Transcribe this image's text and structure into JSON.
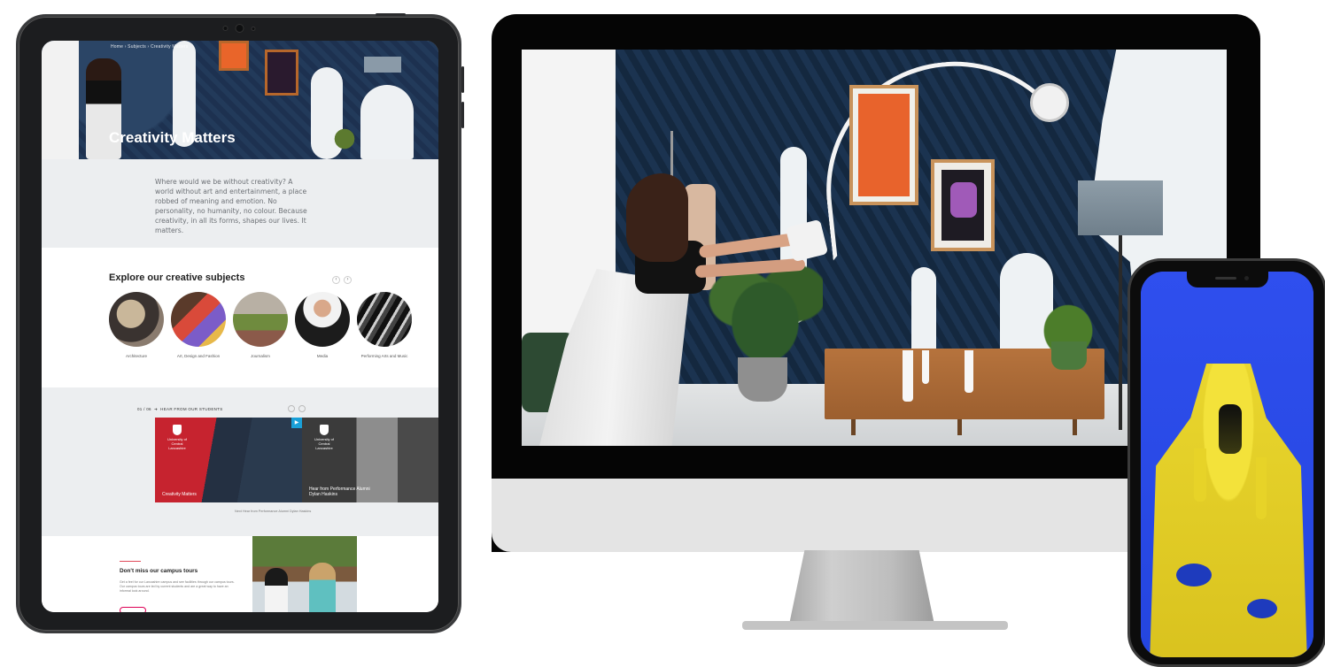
{
  "tablet": {
    "breadcrumb": "Home  ›  Subjects  ›  Creativity Matters",
    "hero_title": "Creativity Matters",
    "intro_text": "Where would we be without creativity? A world without art and entertainment, a place robbed of meaning and emotion. No personality, no humanity, no colour. Because creativity, in all its forms, shapes our lives. It matters.",
    "explore_heading": "Explore our creative subjects",
    "subjects": [
      {
        "label": "Architecture"
      },
      {
        "label": "Art, Design and Fashion"
      },
      {
        "label": "Journalism"
      },
      {
        "label": "Media"
      },
      {
        "label": "Performing Arts and Music"
      }
    ],
    "students_counter": "01 / 06",
    "students_heading": "HEAR FROM OUR STUDENTS",
    "cards": [
      {
        "logo": "University of Central Lancashire",
        "caption": "Creativity Matters"
      },
      {
        "logo": "University of Central Lancashire",
        "caption": "Hear from Performance Alumni Dylan Haskins"
      }
    ],
    "students_footer": "Next\nHear from Performance Alumni Dylan Haskins",
    "tours_heading": "Don't miss our campus tours",
    "tours_text": "Get a feel for our Lancashire campus and see facilities through our campus tours. Our campus tours are led by current students and are a great way to have an informal look around."
  }
}
